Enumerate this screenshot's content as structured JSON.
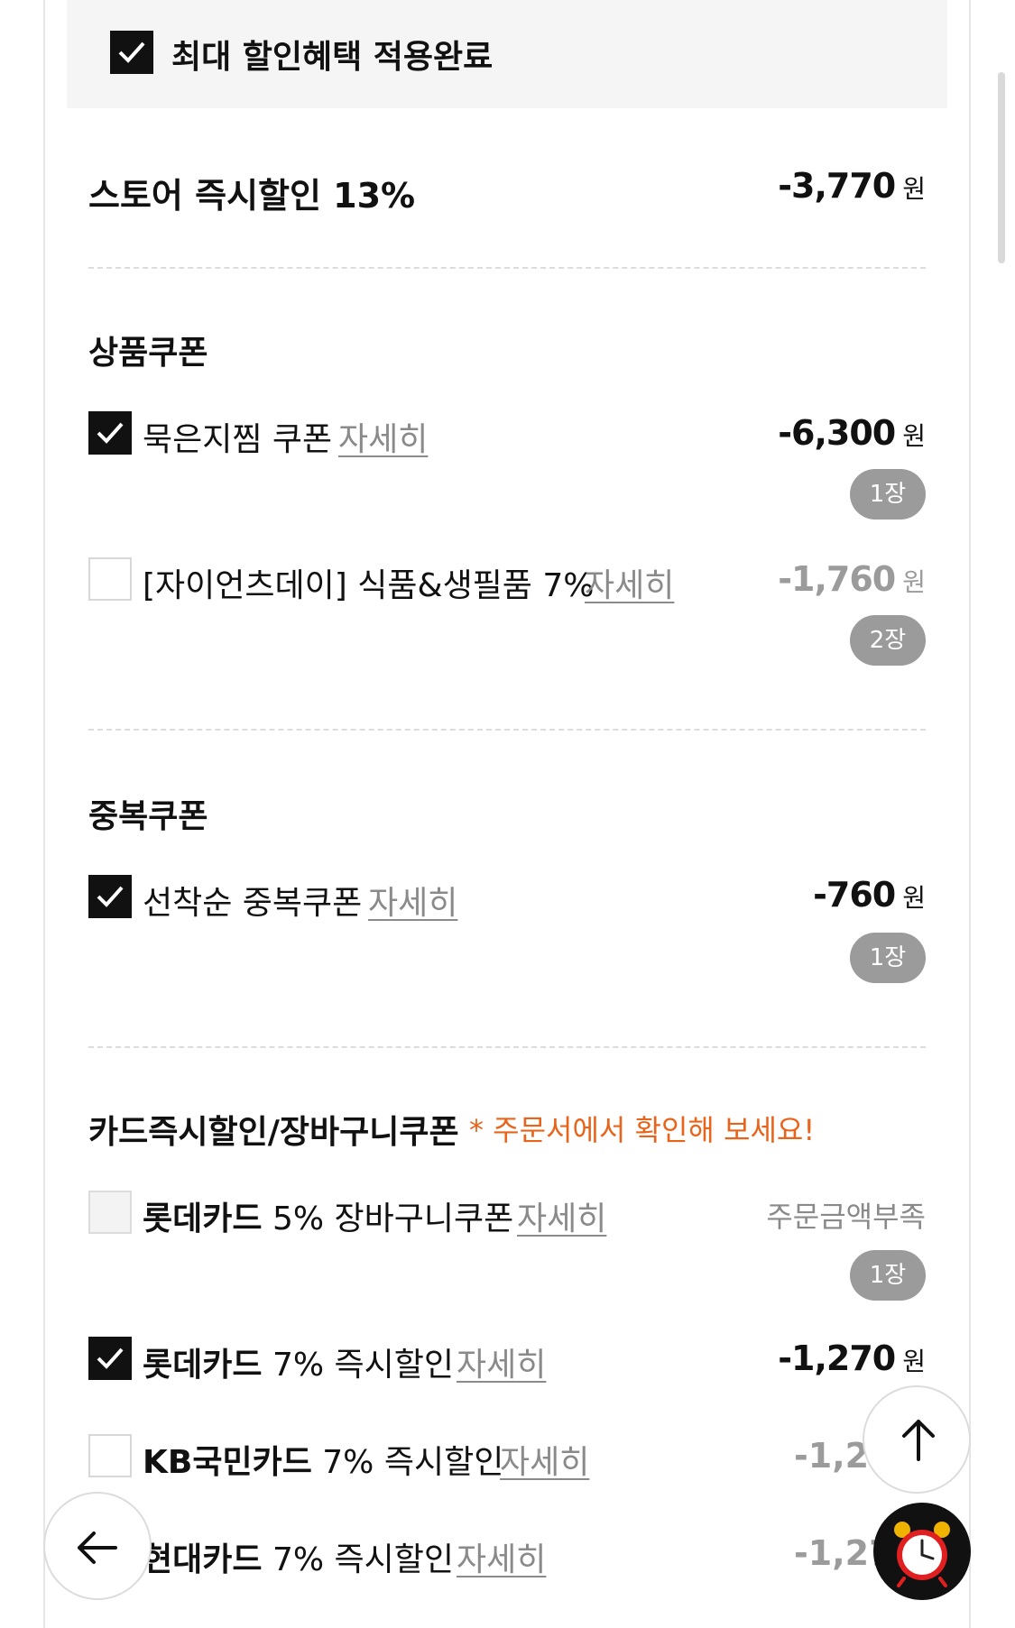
{
  "banner": {
    "label": "최대 할인혜택 적용완료"
  },
  "store_discount": {
    "label": "스토어 즉시할인 13%",
    "amount": "-3,770",
    "unit": "원"
  },
  "product_coupons": {
    "title": "상품쿠폰",
    "items": [
      {
        "name": "묵은지찜 쿠폰",
        "detail": "자세히",
        "amount": "-6,300",
        "unit": "원",
        "count": "1장",
        "checked": true
      },
      {
        "name": "[자이언츠데이] 식품&생필품 7%",
        "detail": "자세히",
        "amount": "-1,760",
        "unit": "원",
        "count": "2장",
        "checked": false
      }
    ]
  },
  "duplicate_coupons": {
    "title": "중복쿠폰",
    "items": [
      {
        "name": "선착순 중복쿠폰",
        "detail": "자세히",
        "amount": "-760",
        "unit": "원",
        "count": "1장",
        "checked": true
      }
    ]
  },
  "card_discounts": {
    "title": "카드즉시할인/장바구니쿠폰",
    "notice": "* 주문서에서 확인해 보세요!",
    "items": [
      {
        "brand": "롯데카드",
        "desc": "5% 장바구니쿠폰",
        "detail": "자세히",
        "status": "주문금액부족",
        "count": "1장",
        "checked": false
      },
      {
        "brand": "롯데카드",
        "desc": "7% 즉시할인",
        "detail": "자세히",
        "amount": "-1,270",
        "unit": "원",
        "checked": true
      },
      {
        "brand": "KB국민카드",
        "desc": "7% 즉시할인",
        "detail": "자세히",
        "amount": "-1,27",
        "checked": false
      },
      {
        "brand": "현대카드",
        "desc": "7% 즉시할인",
        "detail": "자세히",
        "amount": "-1,27",
        "checked": false
      }
    ]
  },
  "colors": {
    "accent": "#e8641b",
    "checked": "#111111",
    "muted": "#9b9b9b",
    "banner_bg": "#f5f5f5"
  },
  "icons": {
    "check": "check-icon",
    "scroll_top": "arrow-up-icon",
    "back": "arrow-left-icon",
    "alarm": "alarm-clock-icon"
  }
}
